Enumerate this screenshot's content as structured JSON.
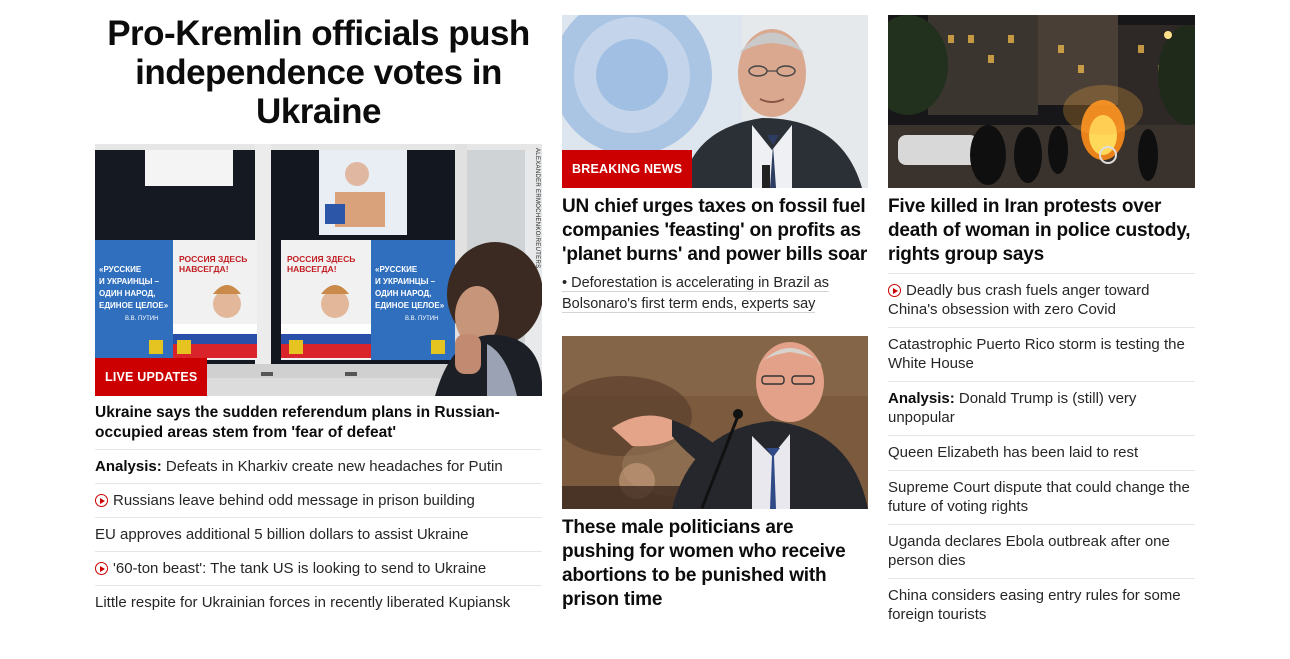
{
  "lead_story": {
    "title": "Pro-Kremlin officials push independence votes in Ukraine",
    "image_credit": "ALEXANDER ERMOCHENKO/REUTERS",
    "poster_text_1": "РОССИЯ ЗДЕСЬ НАВСЕГДА!",
    "poster_text_2": "«РУССКИЕ И УКРАИНЦЫ - ОДИН НАРОД, ЕДИНОЕ ЦЕЛОЕ»",
    "poster_sig": "В.В. ПУТИН",
    "badge": "LIVE UPDATES",
    "headline": "Ukraine says the sudden referendum plans in Russian-occupied areas stem from 'fear of defeat'",
    "related": [
      {
        "prefix": "Analysis:",
        "text": "Defeats in Kharkiv create new headaches for Putin",
        "video": false
      },
      {
        "prefix": "",
        "text": "Russians leave behind odd message in prison building",
        "video": true
      },
      {
        "prefix": "",
        "text": "EU approves additional 5 billion dollars to assist Ukraine",
        "video": false
      },
      {
        "prefix": "",
        "text": "'60-ton beast': The tank US is looking to send to Ukraine",
        "video": true
      },
      {
        "prefix": "",
        "text": "Little respite for Ukrainian forces in recently liberated Kupiansk",
        "video": false
      }
    ]
  },
  "middle": {
    "story1": {
      "badge": "BREAKING NEWS",
      "headline": "UN chief urges taxes on fossil fuel companies 'feasting' on profits as 'planet burns' and power bills soar",
      "sub_link": "• Deforestation is accelerating in Brazil as Bolsonaro's first term ends, experts say"
    },
    "story2": {
      "headline": "These male politicians are pushing for women who receive abortions to be punished with prison time"
    }
  },
  "right": {
    "headline": "Five killed in Iran protests over death of woman in police custody, rights group says",
    "list": [
      {
        "prefix": "",
        "text": "Deadly bus crash fuels anger toward China's obsession with zero Covid",
        "video": true
      },
      {
        "prefix": "",
        "text": "Catastrophic Puerto Rico storm is testing the White House",
        "video": false
      },
      {
        "prefix": "Analysis:",
        "text": "Donald Trump is (still) very unpopular",
        "video": false
      },
      {
        "prefix": "",
        "text": "Queen Elizabeth has been laid to rest",
        "video": false
      },
      {
        "prefix": "",
        "text": "Supreme Court dispute that could change the future of voting rights",
        "video": false
      },
      {
        "prefix": "",
        "text": "Uganda declares Ebola outbreak after one person dies",
        "video": false
      },
      {
        "prefix": "",
        "text": "China considers easing entry rules for some foreign tourists",
        "video": false
      }
    ]
  },
  "colors": {
    "accent_red": "#cc0000",
    "text": "#0c0c0c",
    "divider": "#e6e6e6"
  }
}
